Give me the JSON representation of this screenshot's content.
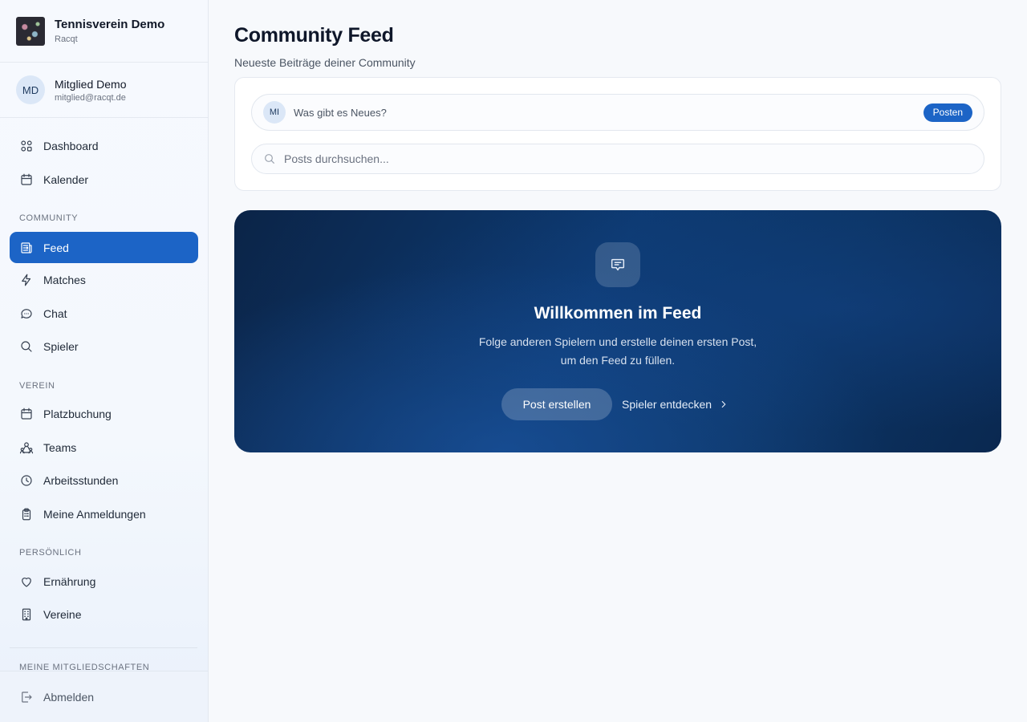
{
  "brand": {
    "name": "Tennisverein Demo",
    "sub": "Racqt"
  },
  "user": {
    "initials": "MD",
    "name": "Mitglied Demo",
    "email": "mitglied@racqt.de"
  },
  "nav": {
    "dashboard": "Dashboard",
    "calendar": "Kalender",
    "section_community": "COMMUNITY",
    "feed": "Feed",
    "matches": "Matches",
    "chat": "Chat",
    "players": "Spieler",
    "section_club": "VEREIN",
    "court_booking": "Platzbuchung",
    "teams": "Teams",
    "work_hours": "Arbeitsstunden",
    "registrations": "Meine Anmeldungen",
    "section_personal": "PERSÖNLICH",
    "nutrition": "Ernährung",
    "clubs": "Vereine",
    "section_memberships": "MEINE MITGLIEDSCHAFTEN",
    "logout": "Abmelden",
    "active": "feed"
  },
  "header": {
    "title": "Community Feed",
    "subtitle": "Neueste Beiträge deiner Community"
  },
  "composer": {
    "initials": "MI",
    "placeholder": "Was gibt es Neues?",
    "post_label": "Posten"
  },
  "search": {
    "placeholder": "Posts durchsuchen..."
  },
  "hero": {
    "title": "Willkommen im Feed",
    "line1": "Folge anderen Spielern und erstelle deinen ersten Post,",
    "line2": "um den Feed zu füllen.",
    "primary_label": "Post erstellen",
    "secondary_label": "Spieler entdecken"
  },
  "colors": {
    "accent": "#1c64c6",
    "hero_dark": "#0b2447"
  },
  "icons": {
    "dashboard": "grid-icon",
    "calendar": "calendar-icon",
    "feed": "newspaper-icon",
    "matches": "lightning-icon",
    "chat": "chat-bubble-icon",
    "players": "search-icon",
    "court_booking": "calendar-icon",
    "teams": "users-icon",
    "work_hours": "clock-icon",
    "registrations": "clipboard-icon",
    "nutrition": "heart-icon",
    "clubs": "building-icon",
    "logout": "logout-icon",
    "hero": "message-icon"
  }
}
